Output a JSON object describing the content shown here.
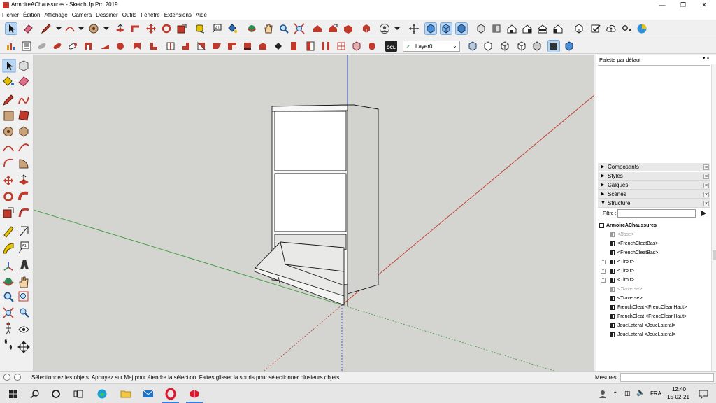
{
  "window": {
    "title": "ArmoireAChaussures - SketchUp Pro 2019",
    "minimize_icon": "minimize-icon",
    "maximize_icon": "maximize-icon",
    "close_icon": "close-icon"
  },
  "menu": [
    "Fichier",
    "Édition",
    "Affichage",
    "Caméra",
    "Dessiner",
    "Outils",
    "Fenêtre",
    "Extensions",
    "Aide"
  ],
  "toolbar": {
    "layer_value": "Layer0"
  },
  "tray": {
    "title": "Palette par défaut",
    "panels": [
      {
        "label": "Composants",
        "expanded": false
      },
      {
        "label": "Styles",
        "expanded": false
      },
      {
        "label": "Calques",
        "expanded": false
      },
      {
        "label": "Scènes",
        "expanded": false
      },
      {
        "label": "Structure",
        "expanded": true
      }
    ],
    "filter_label": "Filtre :",
    "filter_value": "",
    "tree_root": "ArmoireAChaussures",
    "tree_items": [
      {
        "label": "<Base>",
        "hidden": true,
        "expandable": false
      },
      {
        "label": "<FrenchCleatBas>",
        "hidden": false,
        "expandable": false
      },
      {
        "label": "<FrenchCleatBas>",
        "hidden": false,
        "expandable": false
      },
      {
        "label": "<Tiroir>",
        "hidden": false,
        "expandable": true
      },
      {
        "label": "<Tiroir>",
        "hidden": false,
        "expandable": true
      },
      {
        "label": "<Tiroir>",
        "hidden": false,
        "expandable": true
      },
      {
        "label": "<Traverse>",
        "hidden": true,
        "expandable": false
      },
      {
        "label": "<Traverse>",
        "hidden": false,
        "expandable": false
      },
      {
        "label": "FrenchCleat <FrencCleanHaut>",
        "hidden": false,
        "expandable": false
      },
      {
        "label": "FrenchCleat <FrencCleanHaut>",
        "hidden": false,
        "expandable": false
      },
      {
        "label": "JoueLateral <JoueLateral>",
        "hidden": false,
        "expandable": false
      },
      {
        "label": "JoueLateral <JoueLateral>",
        "hidden": false,
        "expandable": false
      }
    ]
  },
  "status": {
    "message": "Sélectionnez les objets. Appuyez sur Maj pour étendre la sélection. Faites glisser la souris pour sélectionner plusieurs objets.",
    "measure_label": "Mesures",
    "measure_value": ""
  },
  "taskbar": {
    "language": "FRA",
    "time": "12:40",
    "date": "15-02-21"
  },
  "colors": {
    "viewport_bg": "#d4d4d0",
    "axis_red": "#c0392b",
    "axis_green": "#3a9a3a",
    "axis_blue": "#2b3fc0",
    "selection_blue": "#b9d6f2"
  }
}
